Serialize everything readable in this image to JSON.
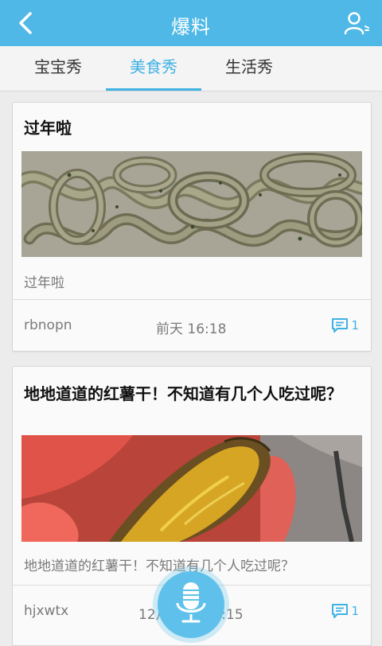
{
  "header": {
    "title": "爆料",
    "back_icon": "back-chevron-icon",
    "user_icon": "user-profile-icon",
    "background": "#4fb8e6"
  },
  "tabs": [
    {
      "label": "宝宝秀",
      "active": false
    },
    {
      "label": "美食秀",
      "active": true
    },
    {
      "label": "生活秀",
      "active": false
    }
  ],
  "accent_color": "#3fb2e4",
  "posts": [
    {
      "title": "过年啦",
      "image": "homemade-noodles-photo",
      "description": "过年啦",
      "author": "rbnopn",
      "time": "前天 16:18",
      "comment_count": "1"
    },
    {
      "title": "地地道道的红薯干！不知道有几个人吃过呢？",
      "image": "dried-sweet-potato-photo",
      "description": "地地道道的红薯干！不知道有几个人吃过呢？",
      "author": "hjxwtx",
      "time": "12月24日 17:15",
      "comment_count": "1"
    }
  ],
  "voice_button_icon": "microphone-icon"
}
